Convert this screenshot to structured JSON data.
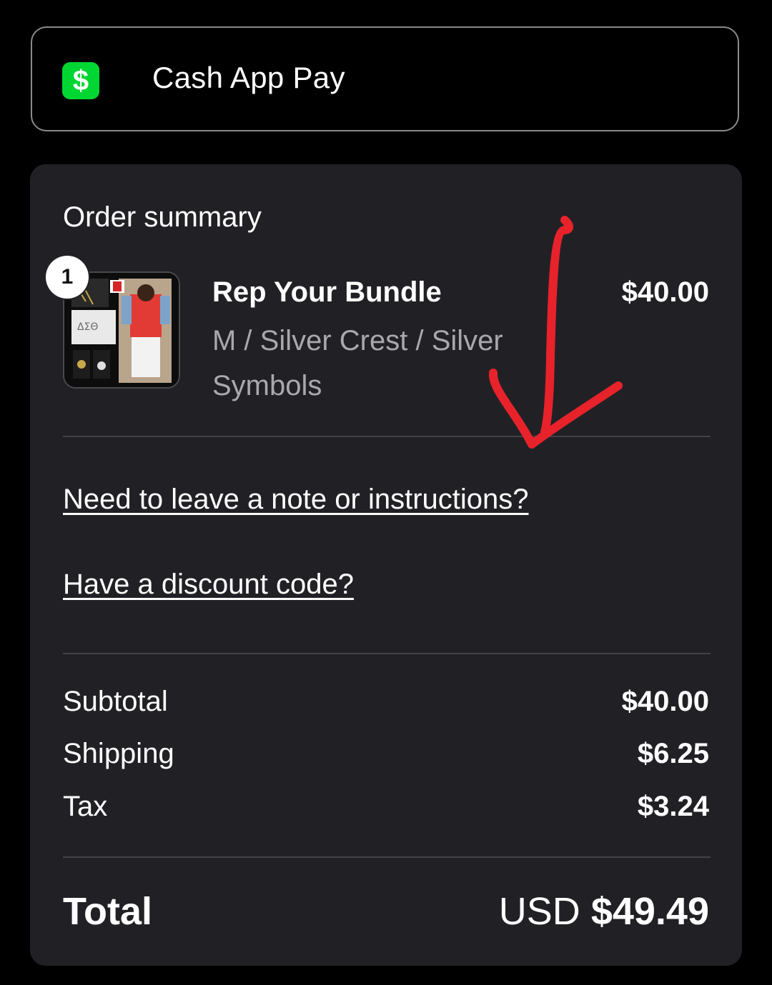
{
  "payment_option": {
    "label": "Cash App Pay",
    "logo_glyph": "$",
    "icon": "cash-app-logo-icon",
    "accent": "#00d632"
  },
  "order_summary": {
    "title": "Order summary",
    "item": {
      "quantity": "1",
      "name": "Rep Your Bundle",
      "variant": "M / Silver Crest / Silver Symbols",
      "price": "$40.00"
    },
    "note_link": "Need to leave a note or instructions?",
    "discount_link": "Have a discount code?",
    "rows": [
      {
        "label": "Subtotal",
        "value": "$40.00"
      },
      {
        "label": "Shipping",
        "value": "$6.25"
      },
      {
        "label": "Tax",
        "value": "$3.24"
      }
    ],
    "total": {
      "label": "Total",
      "currency": "USD",
      "amount": "$49.49"
    }
  },
  "colors": {
    "background": "#000000",
    "panel": "#212125",
    "muted_text": "#a9a9ad",
    "annotation_arrow": "#e8222b"
  }
}
